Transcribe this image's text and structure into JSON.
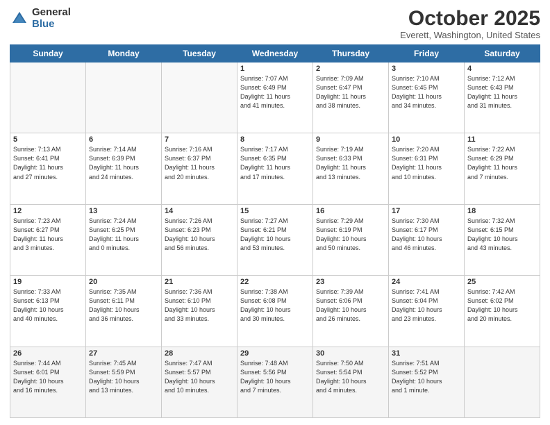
{
  "header": {
    "logo_general": "General",
    "logo_blue": "Blue",
    "month_title": "October 2025",
    "location": "Everett, Washington, United States"
  },
  "weekdays": [
    "Sunday",
    "Monday",
    "Tuesday",
    "Wednesday",
    "Thursday",
    "Friday",
    "Saturday"
  ],
  "weeks": [
    [
      {
        "day": "",
        "info": ""
      },
      {
        "day": "",
        "info": ""
      },
      {
        "day": "",
        "info": ""
      },
      {
        "day": "1",
        "info": "Sunrise: 7:07 AM\nSunset: 6:49 PM\nDaylight: 11 hours\nand 41 minutes."
      },
      {
        "day": "2",
        "info": "Sunrise: 7:09 AM\nSunset: 6:47 PM\nDaylight: 11 hours\nand 38 minutes."
      },
      {
        "day": "3",
        "info": "Sunrise: 7:10 AM\nSunset: 6:45 PM\nDaylight: 11 hours\nand 34 minutes."
      },
      {
        "day": "4",
        "info": "Sunrise: 7:12 AM\nSunset: 6:43 PM\nDaylight: 11 hours\nand 31 minutes."
      }
    ],
    [
      {
        "day": "5",
        "info": "Sunrise: 7:13 AM\nSunset: 6:41 PM\nDaylight: 11 hours\nand 27 minutes."
      },
      {
        "day": "6",
        "info": "Sunrise: 7:14 AM\nSunset: 6:39 PM\nDaylight: 11 hours\nand 24 minutes."
      },
      {
        "day": "7",
        "info": "Sunrise: 7:16 AM\nSunset: 6:37 PM\nDaylight: 11 hours\nand 20 minutes."
      },
      {
        "day": "8",
        "info": "Sunrise: 7:17 AM\nSunset: 6:35 PM\nDaylight: 11 hours\nand 17 minutes."
      },
      {
        "day": "9",
        "info": "Sunrise: 7:19 AM\nSunset: 6:33 PM\nDaylight: 11 hours\nand 13 minutes."
      },
      {
        "day": "10",
        "info": "Sunrise: 7:20 AM\nSunset: 6:31 PM\nDaylight: 11 hours\nand 10 minutes."
      },
      {
        "day": "11",
        "info": "Sunrise: 7:22 AM\nSunset: 6:29 PM\nDaylight: 11 hours\nand 7 minutes."
      }
    ],
    [
      {
        "day": "12",
        "info": "Sunrise: 7:23 AM\nSunset: 6:27 PM\nDaylight: 11 hours\nand 3 minutes."
      },
      {
        "day": "13",
        "info": "Sunrise: 7:24 AM\nSunset: 6:25 PM\nDaylight: 11 hours\nand 0 minutes."
      },
      {
        "day": "14",
        "info": "Sunrise: 7:26 AM\nSunset: 6:23 PM\nDaylight: 10 hours\nand 56 minutes."
      },
      {
        "day": "15",
        "info": "Sunrise: 7:27 AM\nSunset: 6:21 PM\nDaylight: 10 hours\nand 53 minutes."
      },
      {
        "day": "16",
        "info": "Sunrise: 7:29 AM\nSunset: 6:19 PM\nDaylight: 10 hours\nand 50 minutes."
      },
      {
        "day": "17",
        "info": "Sunrise: 7:30 AM\nSunset: 6:17 PM\nDaylight: 10 hours\nand 46 minutes."
      },
      {
        "day": "18",
        "info": "Sunrise: 7:32 AM\nSunset: 6:15 PM\nDaylight: 10 hours\nand 43 minutes."
      }
    ],
    [
      {
        "day": "19",
        "info": "Sunrise: 7:33 AM\nSunset: 6:13 PM\nDaylight: 10 hours\nand 40 minutes."
      },
      {
        "day": "20",
        "info": "Sunrise: 7:35 AM\nSunset: 6:11 PM\nDaylight: 10 hours\nand 36 minutes."
      },
      {
        "day": "21",
        "info": "Sunrise: 7:36 AM\nSunset: 6:10 PM\nDaylight: 10 hours\nand 33 minutes."
      },
      {
        "day": "22",
        "info": "Sunrise: 7:38 AM\nSunset: 6:08 PM\nDaylight: 10 hours\nand 30 minutes."
      },
      {
        "day": "23",
        "info": "Sunrise: 7:39 AM\nSunset: 6:06 PM\nDaylight: 10 hours\nand 26 minutes."
      },
      {
        "day": "24",
        "info": "Sunrise: 7:41 AM\nSunset: 6:04 PM\nDaylight: 10 hours\nand 23 minutes."
      },
      {
        "day": "25",
        "info": "Sunrise: 7:42 AM\nSunset: 6:02 PM\nDaylight: 10 hours\nand 20 minutes."
      }
    ],
    [
      {
        "day": "26",
        "info": "Sunrise: 7:44 AM\nSunset: 6:01 PM\nDaylight: 10 hours\nand 16 minutes."
      },
      {
        "day": "27",
        "info": "Sunrise: 7:45 AM\nSunset: 5:59 PM\nDaylight: 10 hours\nand 13 minutes."
      },
      {
        "day": "28",
        "info": "Sunrise: 7:47 AM\nSunset: 5:57 PM\nDaylight: 10 hours\nand 10 minutes."
      },
      {
        "day": "29",
        "info": "Sunrise: 7:48 AM\nSunset: 5:56 PM\nDaylight: 10 hours\nand 7 minutes."
      },
      {
        "day": "30",
        "info": "Sunrise: 7:50 AM\nSunset: 5:54 PM\nDaylight: 10 hours\nand 4 minutes."
      },
      {
        "day": "31",
        "info": "Sunrise: 7:51 AM\nSunset: 5:52 PM\nDaylight: 10 hours\nand 1 minute."
      },
      {
        "day": "",
        "info": ""
      }
    ]
  ]
}
